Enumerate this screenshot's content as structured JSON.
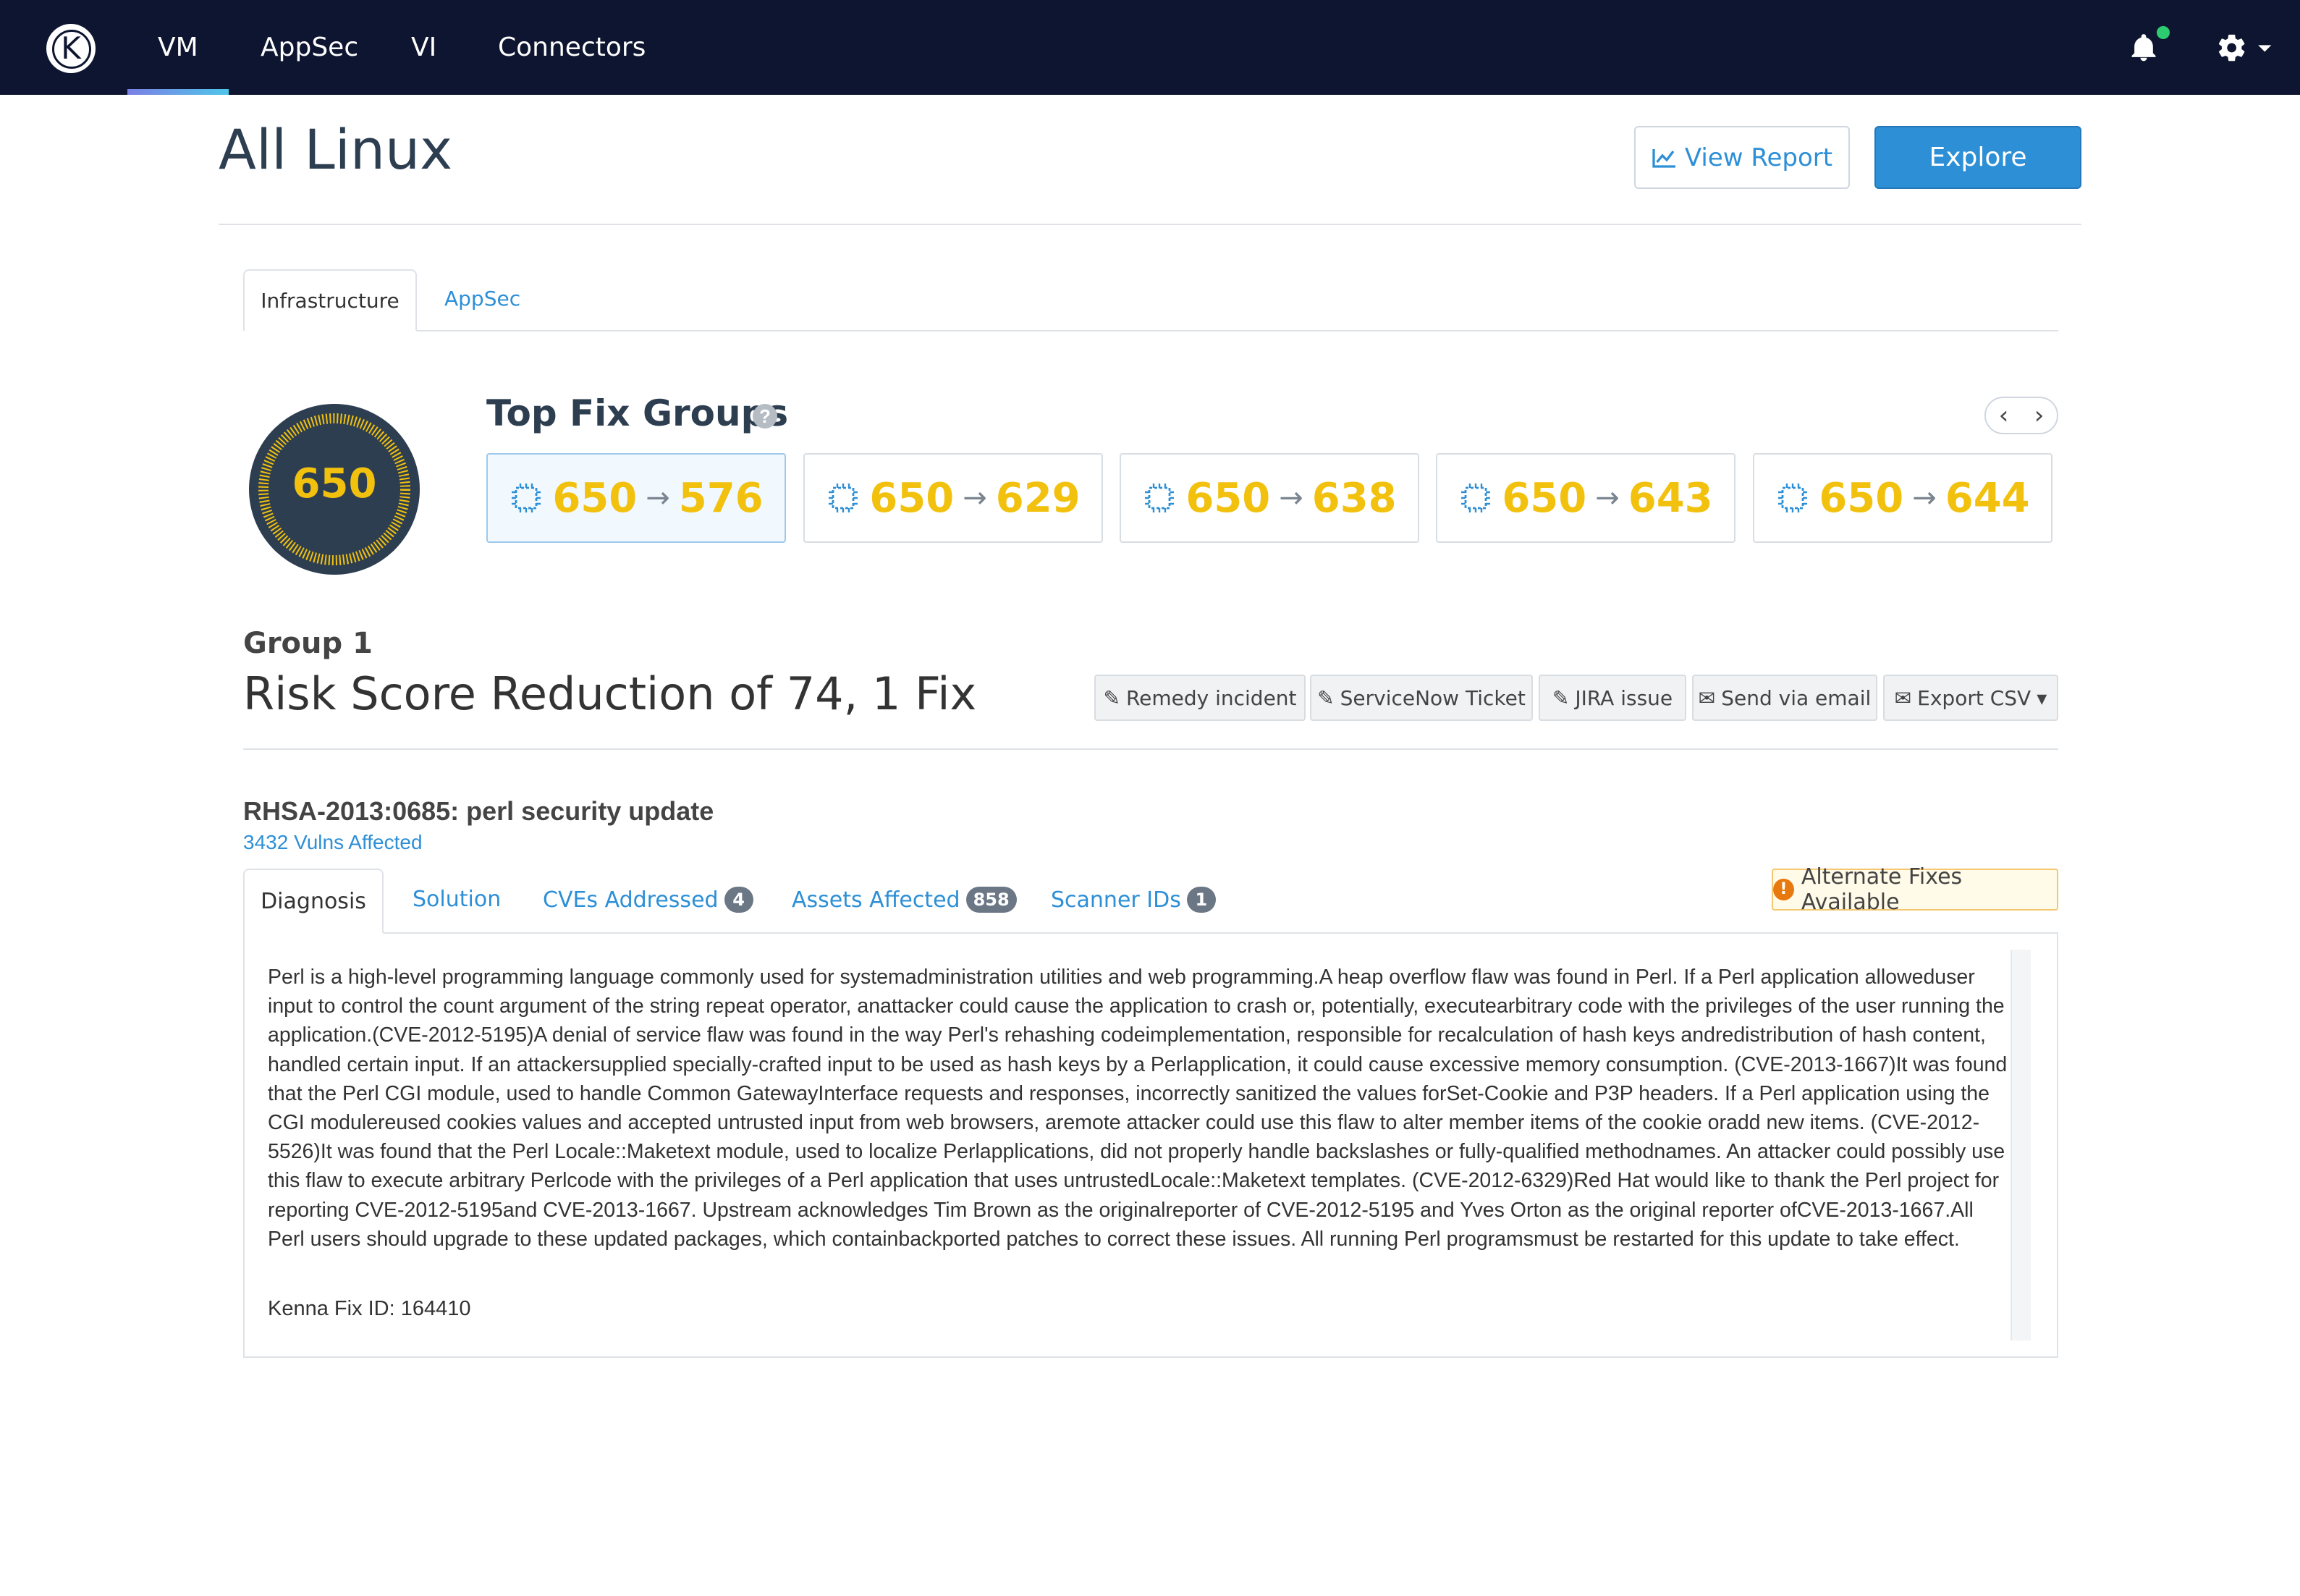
{
  "nav": {
    "logo_letter": "K",
    "items": [
      {
        "label": "VM",
        "active": true
      },
      {
        "label": "AppSec",
        "active": false
      },
      {
        "label": "VI",
        "active": false
      },
      {
        "label": "Connectors",
        "active": false
      }
    ],
    "notification_dot_color": "#2ecc71"
  },
  "header": {
    "title": "All Linux",
    "view_report_label": "View Report",
    "explore_label": "Explore"
  },
  "tabs": {
    "infrastructure": "Infrastructure",
    "appsec": "AppSec"
  },
  "risk_score": "650",
  "top_fix_groups": {
    "title": "Top Fix Groups",
    "prev_glyph": "‹",
    "next_glyph": "›",
    "groups": [
      {
        "from": "650",
        "to": "576",
        "active": true
      },
      {
        "from": "650",
        "to": "629",
        "active": false
      },
      {
        "from": "650",
        "to": "638",
        "active": false
      },
      {
        "from": "650",
        "to": "643",
        "active": false
      },
      {
        "from": "650",
        "to": "644",
        "active": false
      }
    ]
  },
  "group": {
    "label": "Group 1",
    "headline": "Risk Score Reduction of 74, 1 Fix",
    "actions": {
      "remedy": "Remedy incident",
      "servicenow": "ServiceNow Ticket",
      "jira": "JIRA issue",
      "email": "Send via email",
      "export": "Export CSV"
    }
  },
  "fix": {
    "name": "RHSA-2013:0685: perl security update",
    "vulns_affected": "3432 Vulns Affected",
    "alternate_fixes": "Alternate Fixes Available",
    "tabs": {
      "diagnosis": "Diagnosis",
      "solution": "Solution",
      "cves": "CVEs Addressed",
      "cves_count": "4",
      "assets": "Assets Affected",
      "assets_count": "858",
      "scanner": "Scanner IDs",
      "scanner_count": "1"
    },
    "diagnosis_text": "Perl is a high-level programming language commonly used for systemadministration utilities and web programming.A heap overflow flaw was found in Perl. If a Perl application alloweduser input to control the count argument of the string repeat operator, anattacker could cause the application to crash or, potentially, executearbitrary code with the privileges of the user running the application.(CVE-2012-5195)A denial of service flaw was found in the way Perl's rehashing codeimplementation, responsible for recalculation of hash keys andredistribution of hash content, handled certain input. If an attackersupplied specially-crafted input to be used as hash keys by a Perlapplication, it could cause excessive memory consumption. (CVE-2013-1667)It was found that the Perl CGI module, used to handle Common GatewayInterface requests and responses, incorrectly sanitized the values forSet-Cookie and P3P headers. If a Perl application using the CGI modulereused cookies values and accepted untrusted input from web browsers, aremote attacker could use this flaw to alter member items of the cookie oradd new items. (CVE-2012-5526)It was found that the Perl Locale::Maketext module, used to localize Perlapplications, did not properly handle backslashes or fully-qualified methodnames. An attacker could possibly use this flaw to execute arbitrary Perlcode with the privileges of a Perl application that uses untrustedLocale::Maketext templates. (CVE-2012-6329)Red Hat would like to thank the Perl project for reporting CVE-2012-5195and CVE-2013-1667. Upstream acknowledges Tim Brown as the originalreporter of CVE-2012-5195 and Yves Orton as the original reporter ofCVE-2013-1667.All Perl users should upgrade to these updated packages, which containbackported patches to correct these issues. All running Perl programsmust be restarted for this update to take effect.",
    "kenna_fix_id": "Kenna Fix ID: 164410"
  },
  "colors": {
    "nav_bg": "#0e1530",
    "accent_blue": "#2d8fd6",
    "score_yellow": "#f2c10e",
    "alert_orange": "#e8790e"
  }
}
